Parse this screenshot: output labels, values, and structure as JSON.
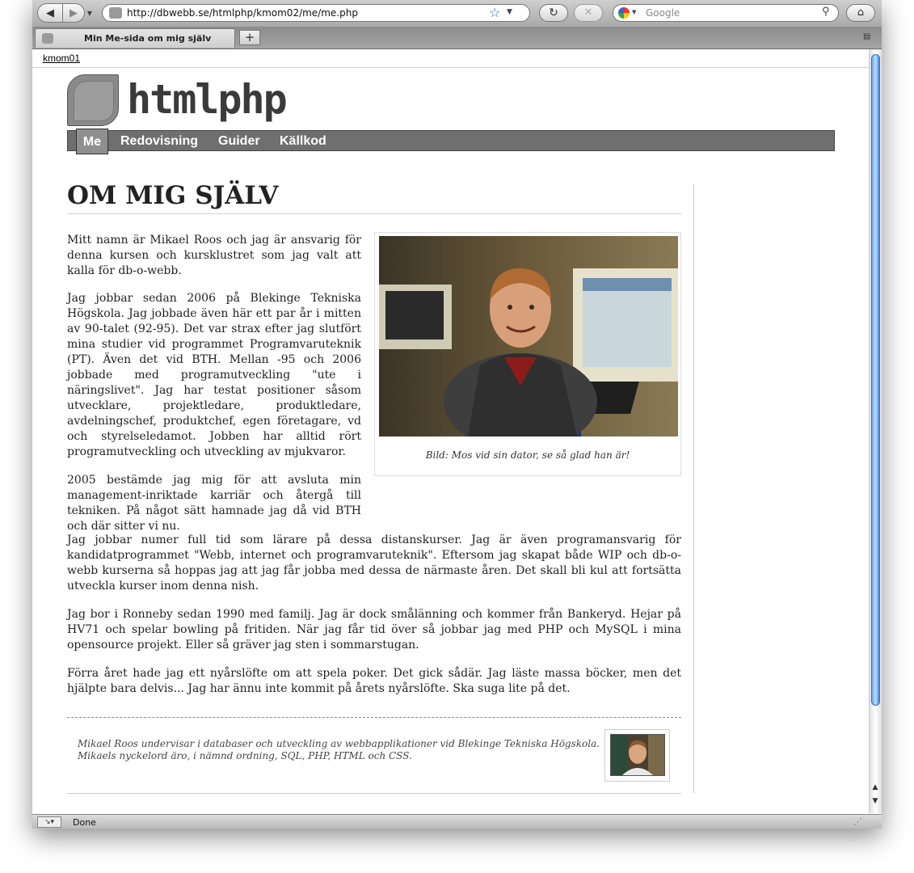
{
  "browser": {
    "url": "http://dbwebb.se/htmlphp/kmom02/me/me.php",
    "search_placeholder": "Google",
    "tab_title": "Min Me-sida om mig själv",
    "new_tab": "+",
    "bookmark": "kmom01",
    "status": "Done"
  },
  "site": {
    "title": "htmlphp",
    "nav": [
      {
        "label": "Me",
        "active": true
      },
      {
        "label": "Redovisning"
      },
      {
        "label": "Guider"
      },
      {
        "label": "Källkod"
      }
    ]
  },
  "article": {
    "heading": "OM MIG SJÄLV",
    "paragraphs": [
      "Mitt namn är Mikael Roos och jag är ansvarig för denna kursen och kursklustret som jag valt att kalla för db-o-webb.",
      "Jag jobbar sedan 2006 på Blekinge Tekniska Högskola. Jag jobbade även här ett par år i mitten av 90-talet (92-95). Det var strax efter jag slutfört mina studier vid programmet Programvaruteknik (PT). Även det vid BTH. Mellan -95 och 2006 jobbade med programutveckling \"ute i näringslivet\". Jag har testat positioner såsom utvecklare, projektledare, produktledare, avdelningschef, produktchef, egen företagare, vd och styrelseledamot. Jobben har alltid rört programutveckling och utveckling av mjukvaror.",
      "2005 bestämde jag mig för att avsluta min management-inriktade karriär och återgå till tekniken. På något sätt hamnade jag då vid BTH och där sitter vi nu.",
      "Jag jobbar numer full tid som lärare på dessa distanskurser. Jag är även programansvarig för kandidatprogrammet \"Webb, internet och programvaruteknik\". Eftersom jag skapat både WIP och db-o-webb kurserna så hoppas jag att jag får jobba med dessa de närmaste åren. Det skall bli kul att fortsätta utveckla kurser inom denna nish.",
      "Jag bor i Ronneby sedan 1990 med familj. Jag är dock smålänning och kommer från Bankeryd. Hejar på HV71 och spelar bowling på fritiden. När jag får tid över så jobbar jag med PHP och MySQL i mina opensource projekt. Eller så gräver jag sten i sommarstugan.",
      "Förra året hade jag ett nyårslöfte om att spela poker. Det gick sådär. Jag läste massa böcker, men det hjälpte bara delvis... Jag har ännu inte kommit på årets nyårslöfte. Ska suga lite på det."
    ],
    "figure_caption": "Bild: Mos vid sin dator, se så glad han är!",
    "byline": "Mikael Roos undervisar i databaser och utveckling av webbapplikationer vid Blekinge Tekniska Högskola. Mikaels nyckelord äro, i nämnd ordning, SQL, PHP, HTML och CSS."
  }
}
